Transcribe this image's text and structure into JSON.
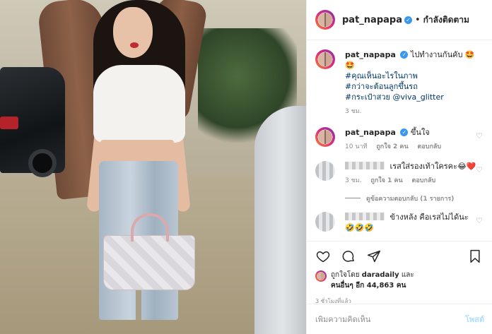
{
  "header": {
    "username": "pat_napapa",
    "verified_mark": "✓",
    "separator": "•",
    "follow_status": "กำลังติดตาม"
  },
  "caption": {
    "username": "pat_napapa",
    "text": "ไปทำงานกันคับ 🤩🤩",
    "hashtags": [
      "#คุณเห็นอะไรในภาพ",
      "#กว่าจะต้อนลูกขึ้นรถ",
      "#กระเป๋าสวย"
    ],
    "mention": "@viva_glitter",
    "time": "3 ชม."
  },
  "comments": [
    {
      "username": "pat_napapa",
      "text": "ขึ้นใจ",
      "time": "10 นาที",
      "likes": "ถูกใจ 2 คน",
      "reply": "ตอบกลับ"
    },
    {
      "text": "เรสใส่รองเท้าใครคะ😂❤️",
      "time": "3 ชม.",
      "likes": "ถูกใจ 1 คน",
      "reply": "ตอบกลับ",
      "view_replies": "ดูข้อความตอบกลับ (1 รายการ)"
    },
    {
      "text": "ข้างหลัง คือเรสไม่ได้นะ",
      "emoji_line": "🤣🤣🤣"
    }
  ],
  "likes": {
    "prefix": "ถูกใจโดย",
    "liked_by": "daradaily",
    "middle": "และ",
    "others": "คนอื่นๆ อีก 44,863 คน"
  },
  "post_time": "3 ชั่วโมงที่แล้ว",
  "add_comment": {
    "placeholder": "เพิ่มความคิดเห็น",
    "post_label": "โพสต์"
  },
  "icons": {
    "like": "heart-icon",
    "comment": "comment-icon",
    "share": "share-icon",
    "save": "bookmark-icon",
    "comment_like": "small-heart-icon"
  },
  "colors": {
    "verified": "#3897f0",
    "link": "#003569",
    "muted": "#8e8e8e",
    "post_button_disabled": "#b2dffc",
    "border": "#efefef"
  }
}
